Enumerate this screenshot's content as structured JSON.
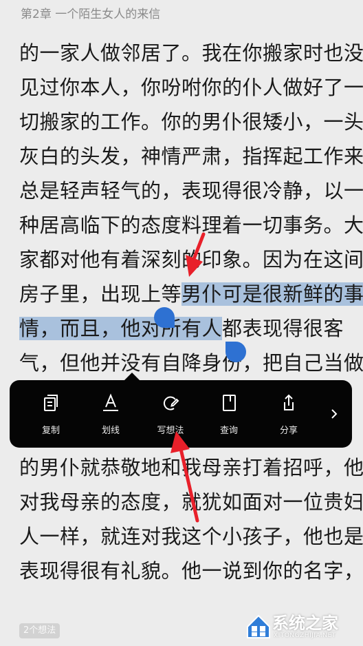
{
  "header": {
    "chapter_title": "第2章 一个陌生女人的来信"
  },
  "content": {
    "lines": [
      "的一家人做邻居了。我在你搬家时也没",
      "见过你本人，你吩咐你的仆人做好了一",
      "切搬家的工作。你的男仆很矮小，一头",
      "灰白的头发，神情严肃，指挥起工作来",
      "总是轻声轻气的，表现得很冷静，以一",
      "种居高临下的态度料理着一切事务。大",
      "家都对他有着深刻的印象。因为在这间"
    ],
    "line8": {
      "before": "房子里，出现上等",
      "selected": "男仆可是很新鲜的事"
    },
    "line9": {
      "selected": "情，而且，他对所有人",
      "after": "都表现得很客"
    },
    "line10": "气，但他并没有自降身份，把自己当做",
    "lines_after": [
      "的男仆就恭敬地和我母亲打着招呼，他",
      "对我母亲的态度，就犹如面对一位贵妇",
      "人一样，就连对我这个小孩子，他也是",
      "表现得很有礼貌。他一说到你的名字，"
    ]
  },
  "toolbar": {
    "items": [
      {
        "label": "复制",
        "icon": "copy-icon"
      },
      {
        "label": "划线",
        "icon": "underline-icon"
      },
      {
        "label": "写想法",
        "icon": "write-thought-icon"
      },
      {
        "label": "查询",
        "icon": "lookup-book-icon"
      },
      {
        "label": "分享",
        "icon": "share-icon"
      }
    ],
    "more_icon": "chevron-right-icon"
  },
  "footer": {
    "thoughts_badge": "2个想法"
  },
  "watermark": {
    "text": "系统之家",
    "sub": "XITONGZHIJIA.NET"
  },
  "colors": {
    "background": "#ececec",
    "selection_highlight": "#a9c1dd",
    "selection_handle": "#2e71d2",
    "toolbar_bg": "#050505",
    "annotation_arrow": "#e8202a"
  }
}
